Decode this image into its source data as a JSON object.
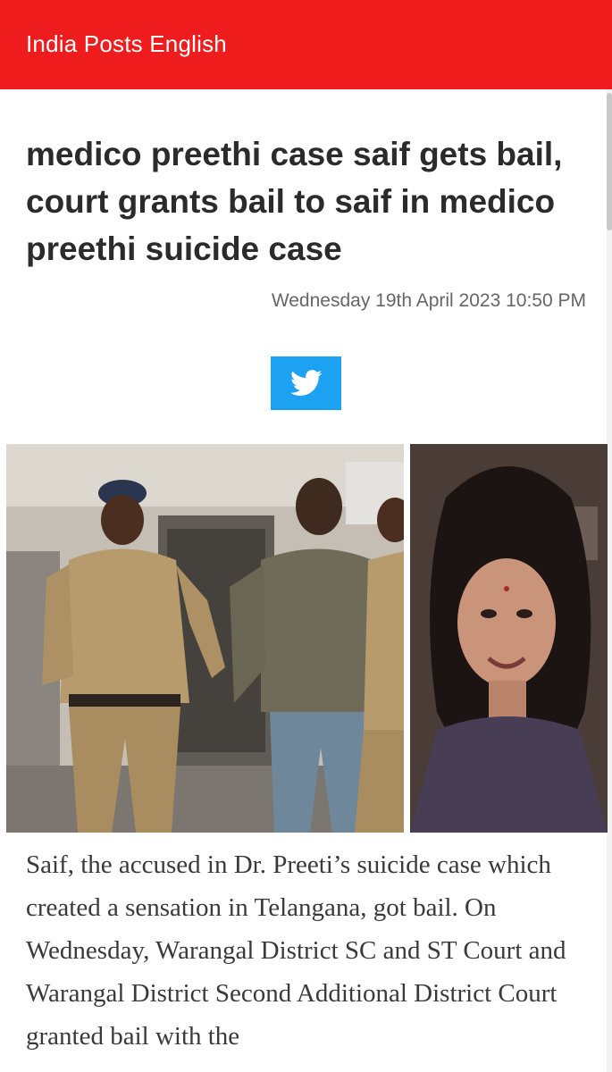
{
  "header": {
    "site_name": "India Posts English",
    "background_color": "#ee1c1c"
  },
  "article": {
    "title": "medico preethi case saif gets bail, court grants bail to saif in medico preethi suicide case",
    "date": "Wednesday 19th April 2023 10:50 PM",
    "share": {
      "icon": "twitter-bird-icon",
      "color": "#1da1f2"
    },
    "image": {
      "left_photo": "police-escorting-accused-photo",
      "right_photo": "victim-portrait-photo"
    },
    "body_text": "Saif, the accused in Dr. Preeti’s suicide case which created a sensation in Telangana, got bail. On Wednesday, Warangal District SC and ST Court and Warangal District Second Additional District Court granted bail with the"
  }
}
